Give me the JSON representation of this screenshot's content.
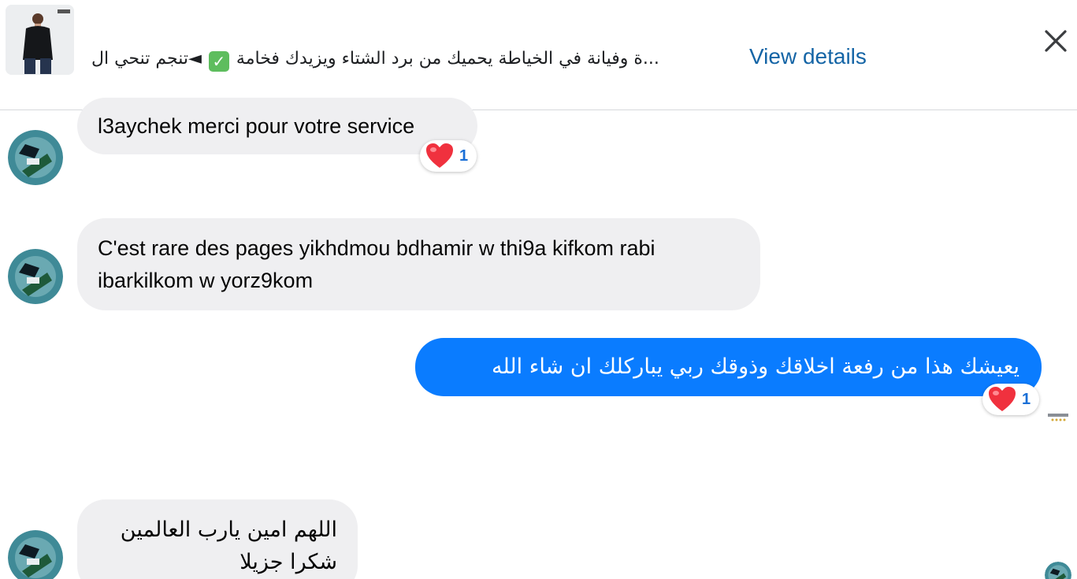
{
  "header": {
    "product_preview": "...ة وفيانة في الخياطة يحميك من برد الشتاء ويزيدك فخامة",
    "product_tail": "◄تنجم تنحي ال",
    "check_icon": "check-mark-icon",
    "view_details_label": "View details",
    "close_icon": "close-icon"
  },
  "messages": [
    {
      "id": "m1",
      "direction": "incoming",
      "text": "l3aychek merci pour votre service",
      "reaction": {
        "icon": "heart-icon",
        "count": "1"
      }
    },
    {
      "id": "m2",
      "direction": "incoming",
      "text": "C'est rare des pages yikhdmou bdhamir w thi9a kifkom rabi ibarkilkom w yorz9kom"
    },
    {
      "id": "m3",
      "direction": "outgoing",
      "text": "يعيشك هذا من رفعة اخلاقك وذوقك ربي يباركلك ان شاء الله",
      "reaction": {
        "icon": "heart-icon",
        "count": "1"
      }
    },
    {
      "id": "m4",
      "direction": "incoming",
      "lines": [
        "اللهم امين يارب العالمين",
        "شكرا جزيلا"
      ]
    }
  ],
  "colors": {
    "outgoing_bubble": "#0a7cff",
    "incoming_bubble": "#efeff1",
    "link": "#1565a6",
    "reaction_count": "#1a6fd6"
  }
}
